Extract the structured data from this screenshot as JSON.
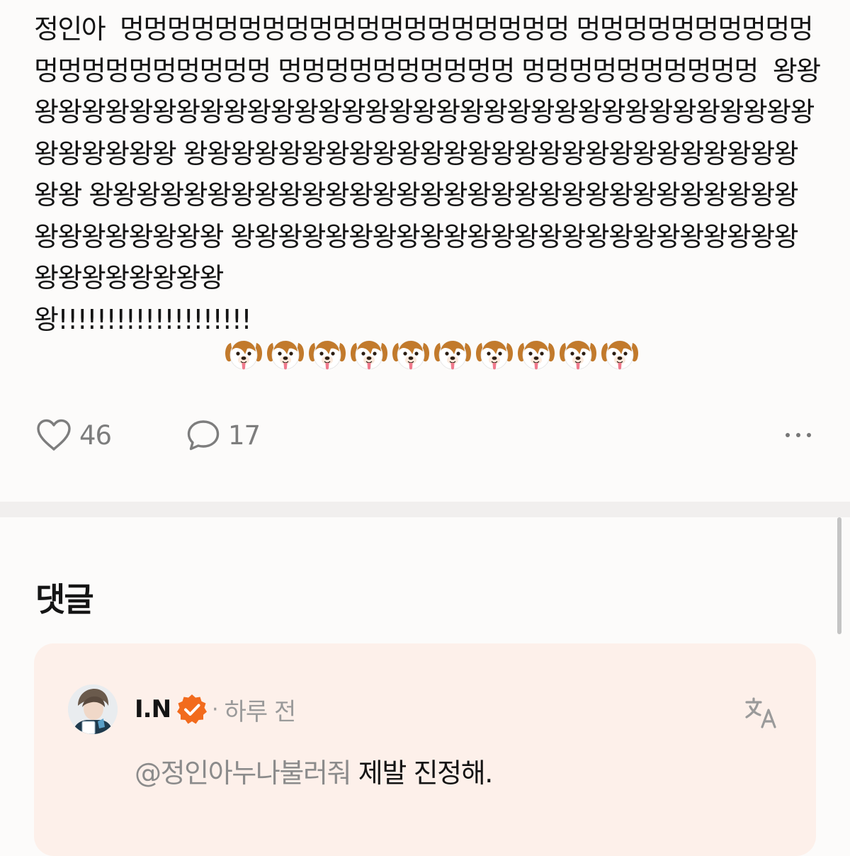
{
  "post": {
    "text": "정인아  멍멍멍멍멍멍멍멍멍멍멍멍멍멍멍멍멍멍멍 멍멍멍멍멍멍멍멍멍멍 멍멍멍멍멍멍멍멍멍멍 멍멍멍멍멍멍멍멍멍멍 멍멍멍멍멍멍멍멍멍멍  왕왕왕왕왕왕왕왕왕왕왕왕왕왕왕왕왕왕왕왕왕왕왕왕왕왕왕왕왕왕왕왕왕왕왕왕왕왕왕왕왕 왕왕왕왕왕왕왕왕왕왕왕왕왕왕왕왕왕왕왕왕왕왕왕왕왕왕왕왕 왕왕왕왕왕왕왕왕왕왕왕왕왕왕왕왕왕왕왕왕왕왕왕왕왕왕왕왕왕왕왕왕왕왕왕왕왕왕 왕왕왕왕왕왕왕왕왕왕왕왕왕왕왕왕왕왕왕왕왕왕왕왕왕왕왕왕왕왕왕왕\n왕!!!!!!!!!!!!!!!!!!!!",
    "emoji": "dog-face",
    "emoji_count": 10
  },
  "actions": {
    "like_icon": "heart-icon",
    "like_count": "46",
    "comment_icon": "speech-bubble-icon",
    "comment_count": "17",
    "more_icon": "more-horizontal-icon"
  },
  "comments": {
    "heading": "댓글",
    "items": [
      {
        "author": "I.N",
        "verified": true,
        "separator": "·",
        "time": "하루 전",
        "mention": "@정인아누나불러줘",
        "text": " 제발 진정해.",
        "translate_icon": "translate-icon"
      }
    ]
  },
  "colors": {
    "background": "#fcfbfa",
    "divider": "#f1efee",
    "comment_card": "#fdf0ea",
    "verified_badge": "#f26b1d",
    "muted_text": "#8b8b8b"
  }
}
